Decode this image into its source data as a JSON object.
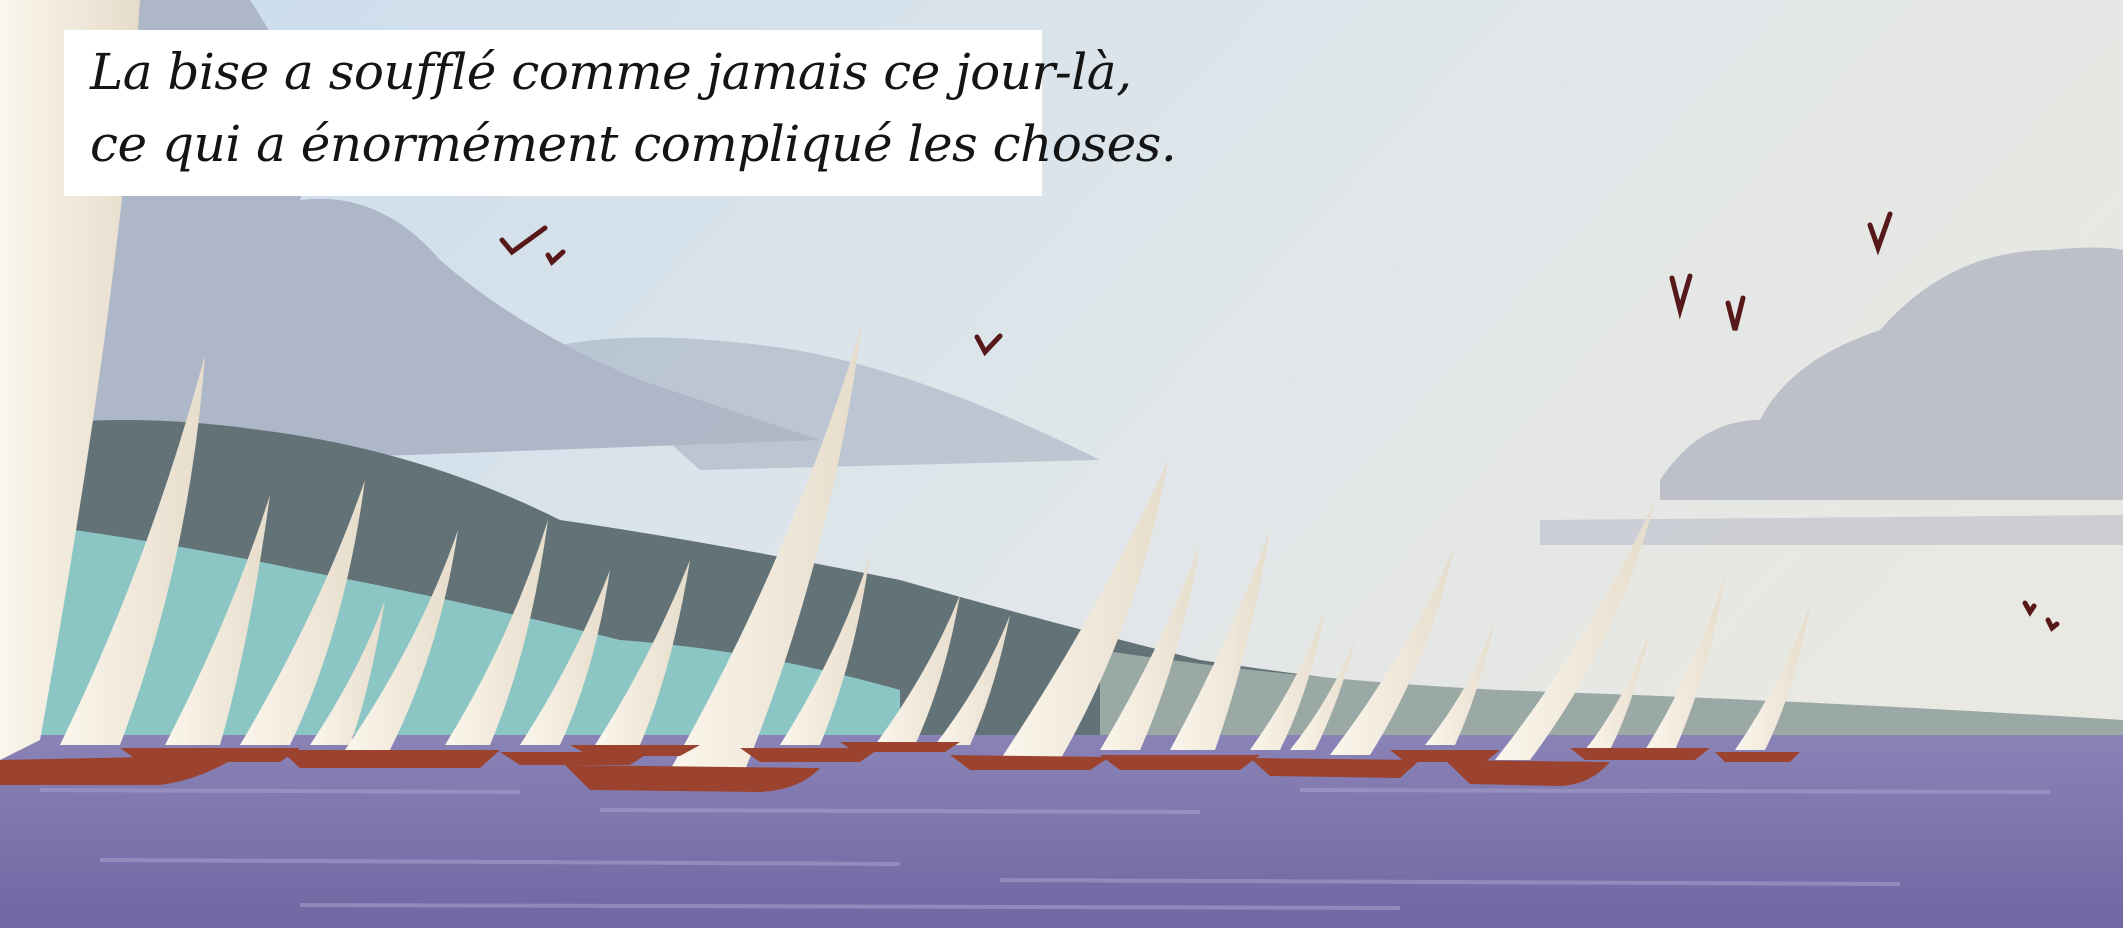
{
  "caption": {
    "line1": "La bise a soufflé comme jamais ce jour-là,",
    "line2": "ce qui a énormément compliqué les choses."
  },
  "colors": {
    "sky_top": "#cfe0ee",
    "sky_right": "#e6e7e2",
    "cloud": "#aeb7c6",
    "hill_dark": "#5f6f73",
    "hill_teal": "#8fc5c6",
    "water": "#7f78ad",
    "sail": "#f6efe2",
    "hull": "#a0442f",
    "bird": "#5a1a1a"
  }
}
